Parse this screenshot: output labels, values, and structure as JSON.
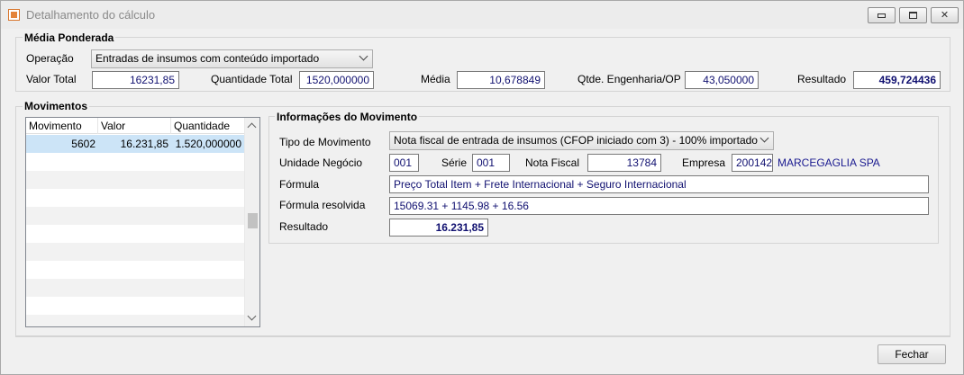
{
  "window": {
    "title": "Detalhamento do cálculo",
    "icon": "app-grid-icon",
    "controls": {
      "minimize": "minimize-icon",
      "maximize": "maximize-icon",
      "close": "✕"
    }
  },
  "media_ponderada": {
    "title": "Média Ponderada",
    "operacao_label": "Operação",
    "operacao_value": "Entradas de insumos com conteúdo importado",
    "valor_total_label": "Valor Total",
    "valor_total": "16231,85",
    "quantidade_total_label": "Quantidade Total",
    "quantidade_total": "1520,000000",
    "media_label": "Média",
    "media": "10,678849",
    "qtde_engenharia_label": "Qtde. Engenharia/OP",
    "qtde_engenharia": "43,050000",
    "resultado_label": "Resultado",
    "resultado": "459,724436"
  },
  "movimentos": {
    "title": "Movimentos",
    "columns": [
      "Movimento",
      "Valor",
      "Quantidade"
    ],
    "rows": [
      {
        "movimento": "5602",
        "valor": "16.231,85",
        "quantidade": "1.520,000000"
      }
    ]
  },
  "informacoes": {
    "title": "Informações do Movimento",
    "tipo_label": "Tipo de Movimento",
    "tipo_value": "Nota fiscal de entrada de insumos (CFOP iniciado com 3) - 100% importado",
    "unidade_label": "Unidade Negócio",
    "unidade_value": "001",
    "serie_label": "Série",
    "serie_value": "001",
    "nota_label": "Nota Fiscal",
    "nota_value": "13784",
    "empresa_label": "Empresa",
    "empresa_value": "200142",
    "empresa_nome": "MARCEGAGLIA SPA",
    "formula_label": "Fórmula",
    "formula_value": "Preço Total Item + Frete Internacional + Seguro Internacional",
    "formula_resolvida_label": "Fórmula resolvida",
    "formula_resolvida_value": "15069.31 + 1145.98 + 16.56",
    "resultado_label": "Resultado",
    "resultado_value": "16.231,85"
  },
  "footer": {
    "fechar_label": "Fechar"
  },
  "colors": {
    "value_blue": "#101070",
    "selected_row": "#cce4f7",
    "empresa_blue": "#1a1a90"
  }
}
